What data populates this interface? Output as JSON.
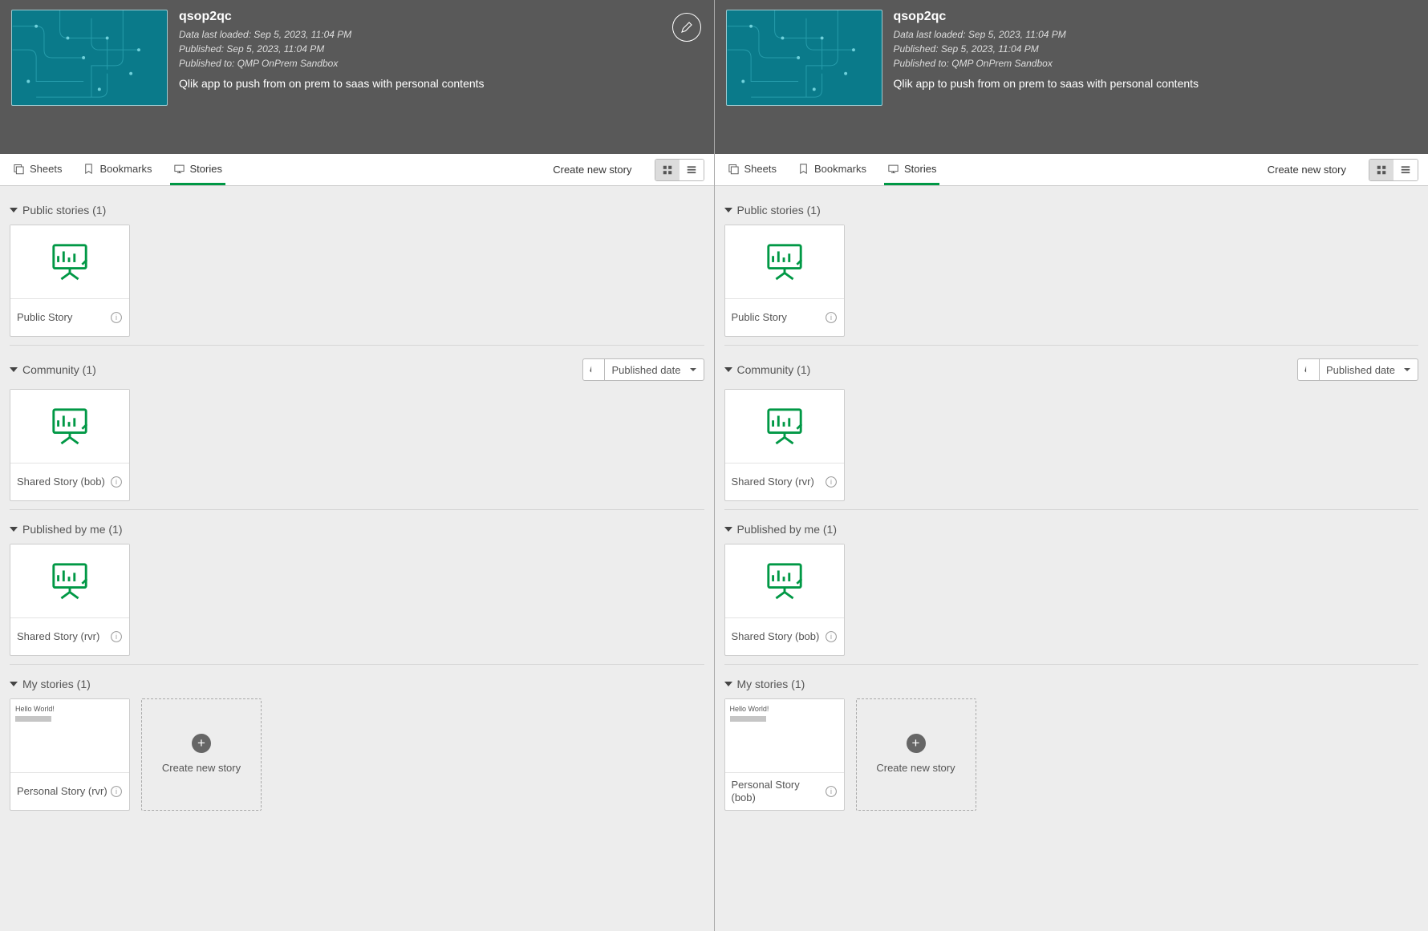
{
  "left": {
    "header": {
      "app_title": "qsop2qc",
      "loaded": "Data last loaded: Sep 5, 2023, 11:04 PM",
      "published": "Published: Sep 5, 2023, 11:04 PM",
      "published_to": "Published to: QMP OnPrem Sandbox",
      "description": "Qlik app to push from on prem to saas with personal contents",
      "has_edit": true
    },
    "tabs": {
      "sheets": "Sheets",
      "bookmarks": "Bookmarks",
      "stories": "Stories",
      "create": "Create new story"
    },
    "sections": {
      "public": {
        "title": "Public stories (1)",
        "card_title": "Public Story"
      },
      "community": {
        "title": "Community (1)",
        "sort": "Published date",
        "card_title": "Shared Story (bob)"
      },
      "pubbyme": {
        "title": "Published by me (1)",
        "card_title": "Shared Story (rvr)"
      },
      "mystories": {
        "title": "My stories (1)",
        "card_title": "Personal Story (rvr)",
        "new_card": "Create new story",
        "mini": "Hello World!"
      }
    }
  },
  "right": {
    "header": {
      "app_title": "qsop2qc",
      "loaded": "Data last loaded: Sep 5, 2023, 11:04 PM",
      "published": "Published: Sep 5, 2023, 11:04 PM",
      "published_to": "Published to: QMP OnPrem Sandbox",
      "description": "Qlik app to push from on prem to saas with personal contents",
      "has_edit": false
    },
    "tabs": {
      "sheets": "Sheets",
      "bookmarks": "Bookmarks",
      "stories": "Stories",
      "create": "Create new story"
    },
    "sections": {
      "public": {
        "title": "Public stories (1)",
        "card_title": "Public Story"
      },
      "community": {
        "title": "Community (1)",
        "sort": "Published date",
        "card_title": "Shared Story (rvr)"
      },
      "pubbyme": {
        "title": "Published by me (1)",
        "card_title": "Shared Story (bob)"
      },
      "mystories": {
        "title": "My stories (1)",
        "card_title": "Personal Story (bob)",
        "new_card": "Create new story",
        "mini": "Hello World!"
      }
    }
  }
}
